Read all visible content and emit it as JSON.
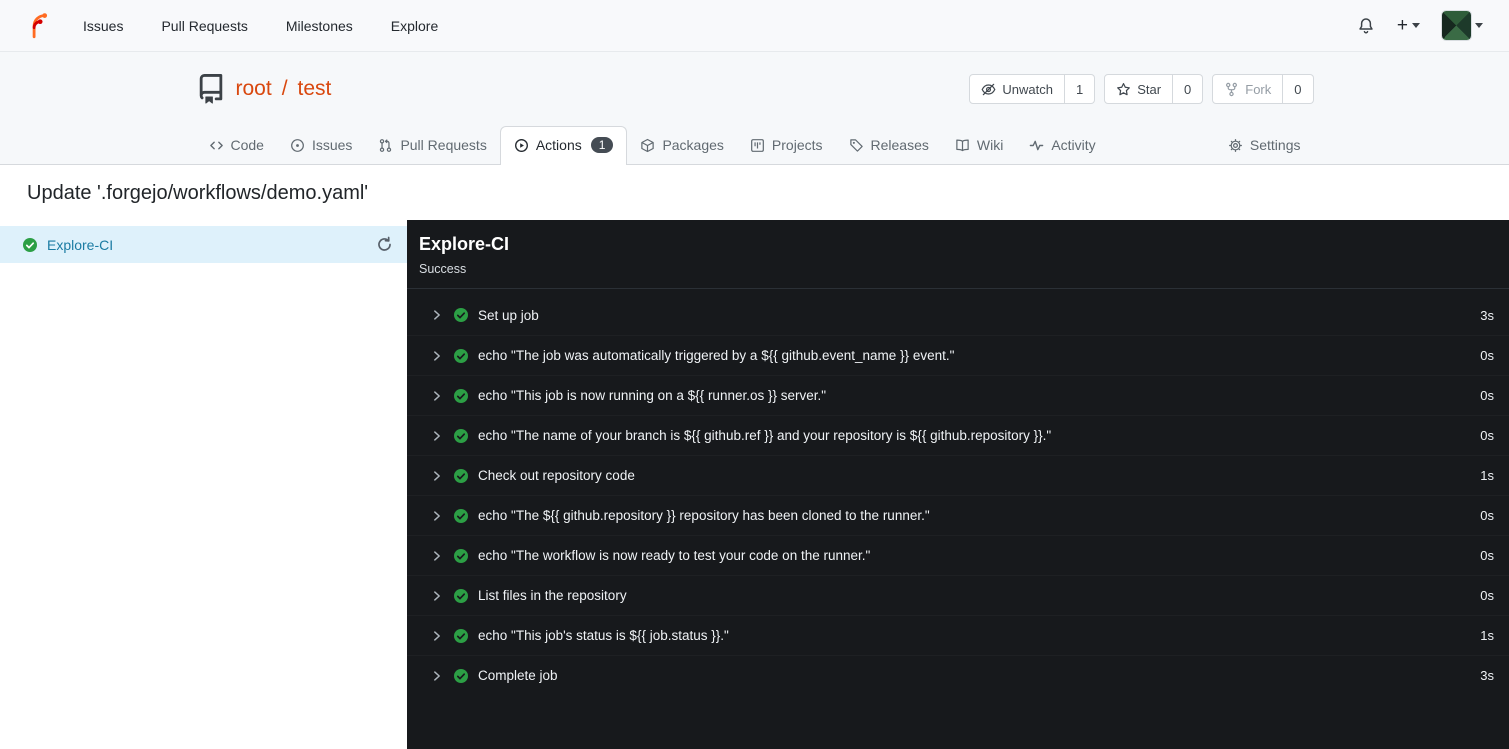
{
  "colors": {
    "brand_orange": "#d9480f",
    "success_green": "#2c9f45",
    "job_link_teal": "#1b7ca3"
  },
  "navbar": {
    "items": [
      {
        "label": "Issues"
      },
      {
        "label": "Pull Requests"
      },
      {
        "label": "Milestones"
      },
      {
        "label": "Explore"
      }
    ]
  },
  "repo": {
    "owner": "root",
    "separator": "/",
    "name": "test",
    "buttons": {
      "unwatch": {
        "label": "Unwatch",
        "count": "1"
      },
      "star": {
        "label": "Star",
        "count": "0"
      },
      "fork": {
        "label": "Fork",
        "count": "0"
      }
    },
    "tabs": [
      {
        "label": "Code"
      },
      {
        "label": "Issues"
      },
      {
        "label": "Pull Requests"
      },
      {
        "label": "Actions",
        "badge": "1"
      },
      {
        "label": "Packages"
      },
      {
        "label": "Projects"
      },
      {
        "label": "Releases"
      },
      {
        "label": "Wiki"
      },
      {
        "label": "Activity"
      },
      {
        "label": "Settings"
      }
    ]
  },
  "run": {
    "title": "Update '.forgejo/workflows/demo.yaml'",
    "sidebar": {
      "jobs": [
        {
          "name": "Explore-CI",
          "status": "success"
        }
      ]
    },
    "panel": {
      "title": "Explore-CI",
      "status": "Success",
      "steps": [
        {
          "name": "Set up job",
          "duration": "3s"
        },
        {
          "name": "echo \"The job was automatically triggered by a ${{ github.event_name }} event.\"",
          "duration": "0s"
        },
        {
          "name": "echo \"This job is now running on a ${{ runner.os }} server.\"",
          "duration": "0s"
        },
        {
          "name": "echo \"The name of your branch is ${{ github.ref }} and your repository is ${{ github.repository }}.\"",
          "duration": "0s"
        },
        {
          "name": "Check out repository code",
          "duration": "1s"
        },
        {
          "name": "echo \"The ${{ github.repository }} repository has been cloned to the runner.\"",
          "duration": "0s"
        },
        {
          "name": "echo \"The workflow is now ready to test your code on the runner.\"",
          "duration": "0s"
        },
        {
          "name": "List files in the repository",
          "duration": "0s"
        },
        {
          "name": "echo \"This job's status is ${{ job.status }}.\"",
          "duration": "1s"
        },
        {
          "name": "Complete job",
          "duration": "3s"
        }
      ]
    }
  }
}
